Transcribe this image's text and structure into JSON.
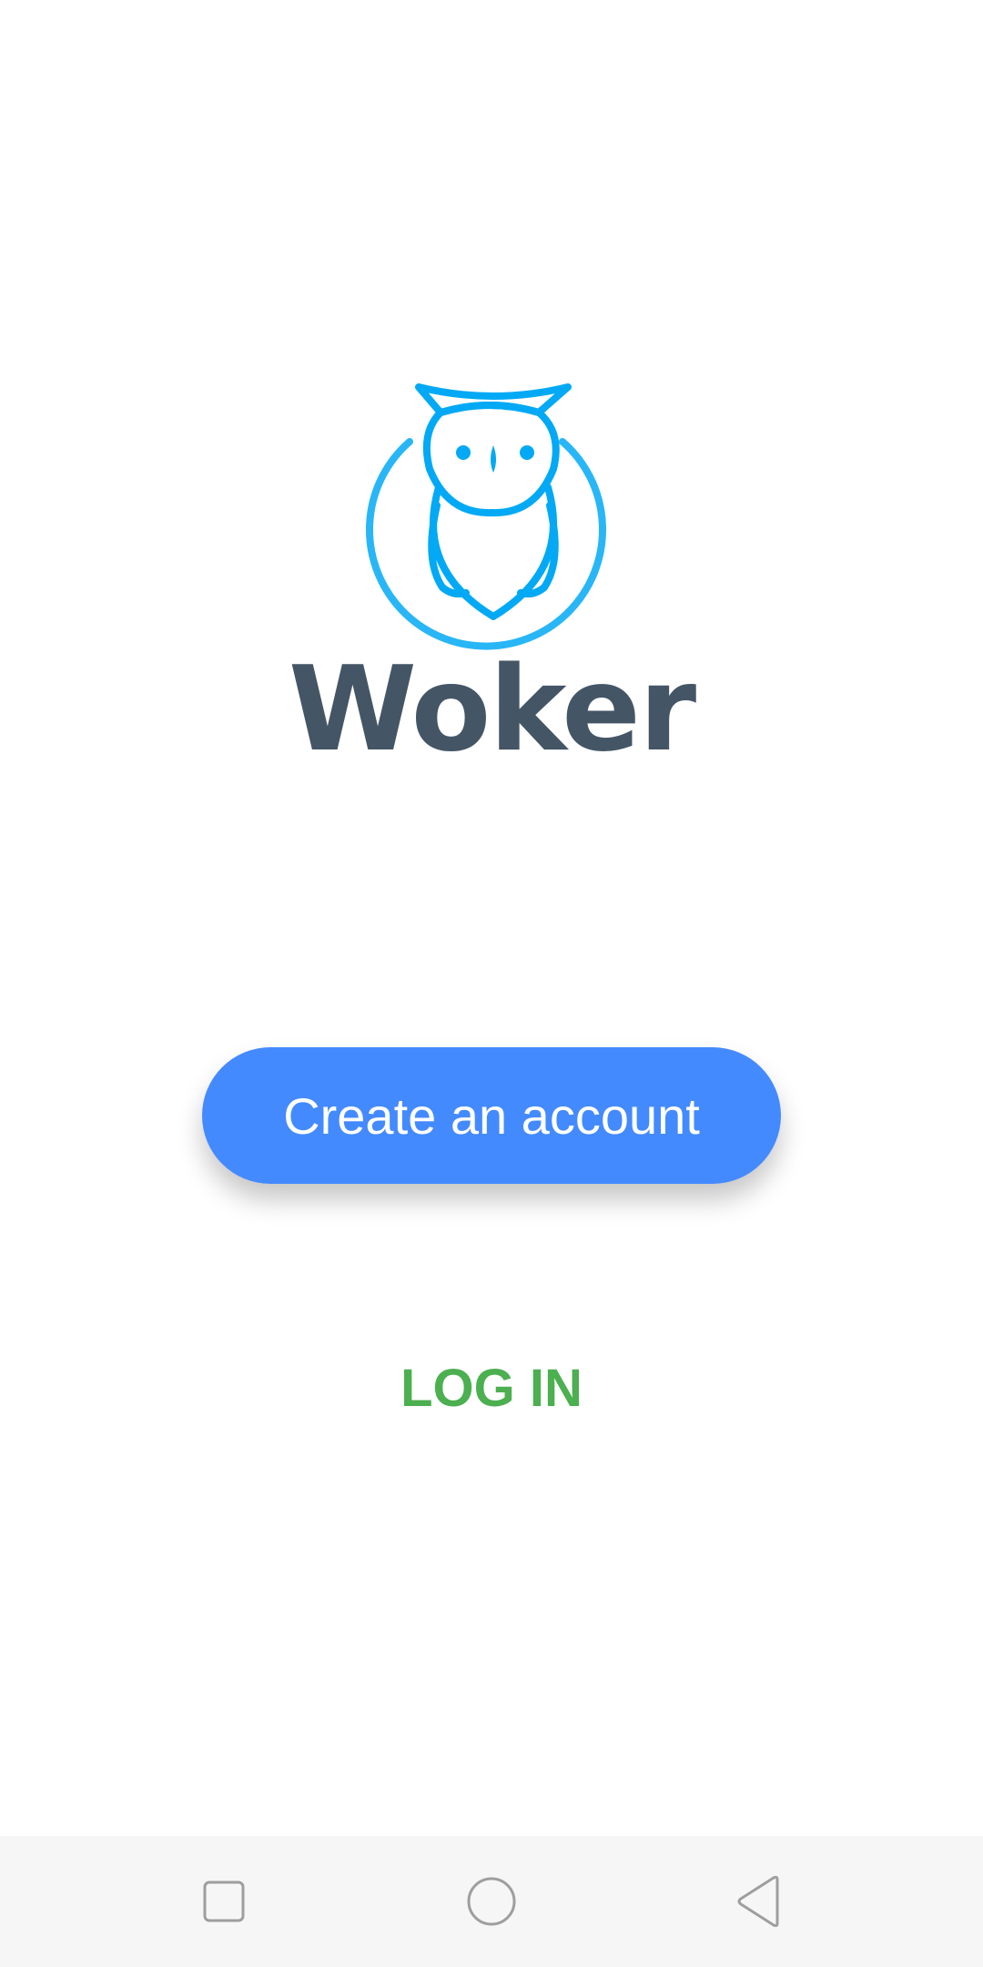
{
  "app": {
    "name": "Woker",
    "logo_icon": "owl-logo",
    "brand_color": "#29B6F6"
  },
  "actions": {
    "create_account_label": "Create an account",
    "create_account_color": "#448AFF",
    "login_label": "LOG IN",
    "login_color": "#4CAF50"
  },
  "system_nav": {
    "recent_icon": "square-icon",
    "home_icon": "circle-icon",
    "back_icon": "triangle-back-icon"
  }
}
